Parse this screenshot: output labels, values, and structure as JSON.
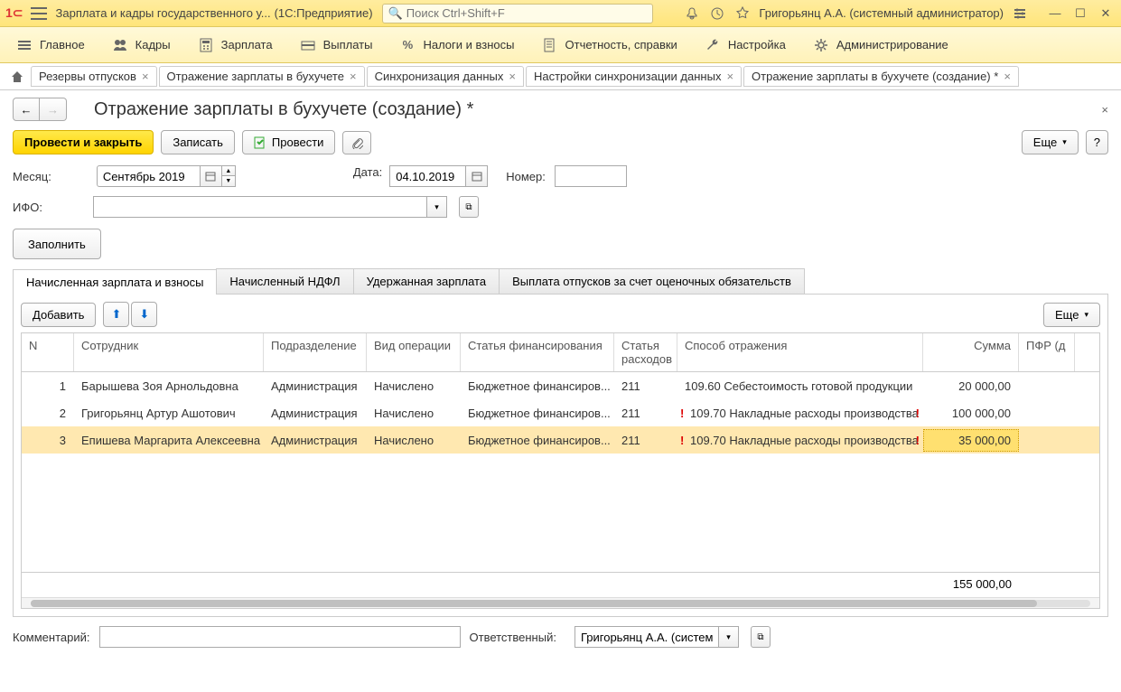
{
  "titlebar": {
    "app_name": "Зарплата и кадры государственного у...",
    "platform": "(1С:Предприятие)",
    "search_placeholder": "Поиск Ctrl+Shift+F",
    "user": "Григорьянц А.А. (системный администратор)"
  },
  "nav": {
    "items": [
      {
        "label": "Главное"
      },
      {
        "label": "Кадры"
      },
      {
        "label": "Зарплата"
      },
      {
        "label": "Выплаты"
      },
      {
        "label": "Налоги и взносы"
      },
      {
        "label": "Отчетность, справки"
      },
      {
        "label": "Настройка"
      },
      {
        "label": "Администрирование"
      }
    ]
  },
  "tabs": [
    {
      "label": "Резервы отпусков"
    },
    {
      "label": "Отражение зарплаты в бухучете"
    },
    {
      "label": "Синхронизация данных"
    },
    {
      "label": "Настройки синхронизации данных"
    },
    {
      "label": "Отражение зарплаты в бухучете (создание) *"
    }
  ],
  "doc": {
    "title": "Отражение зарплаты в бухучете (создание) *",
    "buttons": {
      "post_close": "Провести и закрыть",
      "save": "Записать",
      "post": "Провести",
      "more": "Еще"
    },
    "labels": {
      "month": "Месяц:",
      "date": "Дата:",
      "number": "Номер:",
      "ifo": "ИФО:",
      "fill": "Заполнить",
      "comment": "Комментарий:",
      "responsible": "Ответственный:"
    },
    "month_value": "Сентябрь 2019",
    "date_value": "04.10.2019",
    "number_value": "",
    "ifo_value": "",
    "comment_value": "",
    "responsible_value": "Григорьянц А.А. (системн"
  },
  "inner_tabs": [
    {
      "label": "Начисленная зарплата и взносы"
    },
    {
      "label": "Начисленный НДФЛ"
    },
    {
      "label": "Удержанная зарплата"
    },
    {
      "label": "Выплата отпусков за счет оценочных обязательств"
    }
  ],
  "table_toolbar": {
    "add": "Добавить",
    "more": "Еще"
  },
  "table": {
    "headers": {
      "n": "N",
      "employee": "Сотрудник",
      "department": "Подразделение",
      "operation": "Вид операции",
      "financing": "Статья финансирования",
      "expense": "Статья расходов",
      "reflection": "Способ отражения",
      "sum": "Сумма",
      "pfr": "ПФР (д"
    },
    "rows": [
      {
        "n": "1",
        "employee": "Барышева Зоя Арнольдовна",
        "department": "Администрация",
        "operation": "Начислено",
        "financing": "Бюджетное финансиров...",
        "expense": "211",
        "reflection": "109.60 Себестоимость готовой продукции",
        "sum": "20 000,00",
        "warn": false
      },
      {
        "n": "2",
        "employee": "Григорьянц Артур Ашотович",
        "department": "Администрация",
        "operation": "Начислено",
        "financing": "Бюджетное финансиров...",
        "expense": "211",
        "reflection": "109.70 Накладные расходы производства",
        "sum": "100 000,00",
        "warn": true
      },
      {
        "n": "3",
        "employee": "Епишева Маргарита Алексеевна",
        "department": "Администрация",
        "operation": "Начислено",
        "financing": "Бюджетное финансиров...",
        "expense": "211",
        "reflection": "109.70 Накладные расходы производства",
        "sum": "35 000,00",
        "warn": true
      }
    ],
    "total_sum": "155 000,00"
  }
}
